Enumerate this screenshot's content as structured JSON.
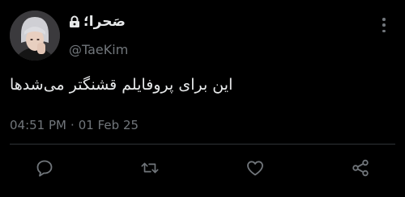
{
  "tweet": {
    "display_name": "صَحرا؛",
    "handle": "@TaeKim",
    "text": "این برای پروفایلم قشنگتر می‌شدها",
    "time": "04:51 PM",
    "separator": "·",
    "date": "01 Feb 25"
  },
  "icons": {
    "lock": "lock-icon",
    "more": "more-vertical-icon",
    "reply": "reply-icon",
    "retweet": "retweet-icon",
    "like": "heart-icon",
    "share": "share-icon"
  },
  "colors": {
    "background": "#000000",
    "primary_text": "#e7e9ea",
    "secondary_text": "#71767b",
    "divider": "#2f3336"
  }
}
